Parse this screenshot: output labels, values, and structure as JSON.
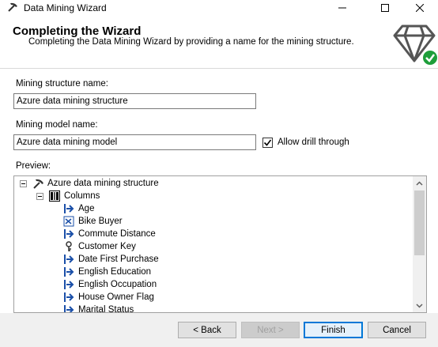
{
  "window": {
    "title": "Data Mining Wizard"
  },
  "header": {
    "title": "Completing the Wizard",
    "subtitle": "Completing the Data Mining Wizard by providing a name for the mining structure."
  },
  "form": {
    "structure_name_label": "Mining structure name:",
    "structure_name_value": "Azure data mining structure",
    "model_name_label": "Mining model name:",
    "model_name_value": "Azure data mining model",
    "drill_through_label": "Allow drill through",
    "drill_through_checked": true,
    "preview_label": "Preview:"
  },
  "preview": {
    "root": "Azure data mining structure",
    "columns_label": "Columns",
    "columns": [
      {
        "name": "Age",
        "icon": "input-column-icon"
      },
      {
        "name": "Bike Buyer",
        "icon": "predict-column-icon"
      },
      {
        "name": "Commute Distance",
        "icon": "input-column-icon"
      },
      {
        "name": "Customer Key",
        "icon": "key-column-icon"
      },
      {
        "name": "Date First Purchase",
        "icon": "input-column-icon"
      },
      {
        "name": "English Education",
        "icon": "input-column-icon"
      },
      {
        "name": "English Occupation",
        "icon": "input-column-icon"
      },
      {
        "name": "House Owner Flag",
        "icon": "input-column-icon"
      },
      {
        "name": "Marital Status",
        "icon": "input-column-icon"
      }
    ]
  },
  "buttons": {
    "back": "< Back",
    "next": "Next >",
    "finish": "Finish",
    "cancel": "Cancel"
  },
  "colors": {
    "accent": "#0078d7",
    "check_green": "#1e9e3a",
    "input_arrow": "#1a4fa8"
  }
}
